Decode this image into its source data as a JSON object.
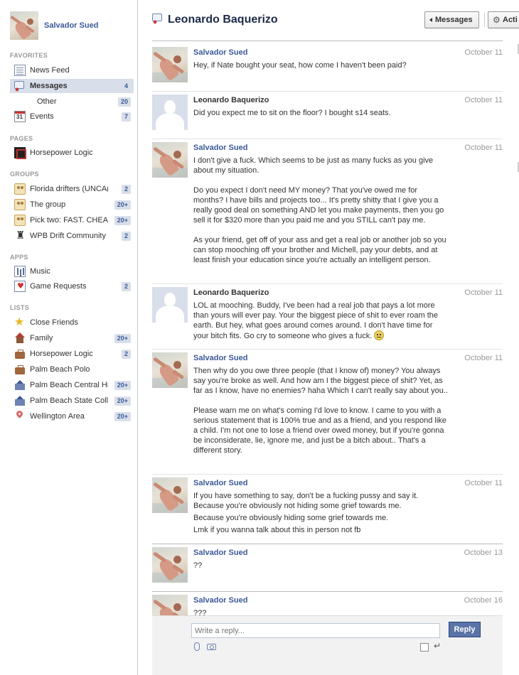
{
  "user": {
    "name": "Salvador Sued"
  },
  "sidebar": {
    "favorites_heading": "FAVORITES",
    "favorites": [
      {
        "label": "News Feed",
        "icon": "news-feed-icon",
        "badge": ""
      },
      {
        "label": "Messages",
        "icon": "messages-icon",
        "badge": "4"
      },
      {
        "label": "Other",
        "icon": "",
        "badge": "20"
      },
      {
        "label": "Events",
        "icon": "calendar-icon",
        "badge": "7"
      }
    ],
    "pages_heading": "PAGES",
    "pages": [
      {
        "label": "Horsepower Logic",
        "icon": "page-icon",
        "badge": ""
      }
    ],
    "groups_heading": "GROUPS",
    "groups": [
      {
        "label": "Florida drifters (UNCA(",
        "icon": "group-icon",
        "badge": "2"
      },
      {
        "label": "The group",
        "icon": "group-icon",
        "badge": "20+"
      },
      {
        "label": "Pick two: FAST. CHEA",
        "icon": "group-icon",
        "badge": "20+"
      },
      {
        "label": "WPB Drift Community",
        "icon": "rook-icon",
        "badge": "2"
      }
    ],
    "apps_heading": "APPS",
    "apps": [
      {
        "label": "Music",
        "icon": "music-icon",
        "badge": ""
      },
      {
        "label": "Game Requests",
        "icon": "game-icon",
        "badge": "2"
      }
    ],
    "lists_heading": "LISTS",
    "lists": [
      {
        "label": "Close Friends",
        "icon": "star-icon",
        "badge": ""
      },
      {
        "label": "Family",
        "icon": "house-icon",
        "badge": "20+"
      },
      {
        "label": "Horsepower Logic",
        "icon": "briefcase-icon",
        "badge": "2"
      },
      {
        "label": "Palm Beach Polo",
        "icon": "briefcase-icon",
        "badge": ""
      },
      {
        "label": "Palm Beach Central Hi",
        "icon": "school-icon",
        "badge": "20+"
      },
      {
        "label": "Palm Beach State Colle",
        "icon": "school-icon",
        "badge": "20+"
      },
      {
        "label": "Wellington Area",
        "icon": "location-pin-icon",
        "badge": "20+"
      }
    ]
  },
  "conversation": {
    "title": "Leonardo Baquerizo",
    "messages_button": "Messages",
    "actions_button": "Acti",
    "messages": [
      {
        "author": "Salvador Sued",
        "date": "October 11",
        "paragraphs": [
          "Hey, if Nate bought your seat, how come I haven't been paid?"
        ]
      },
      {
        "author": "Leonardo Baquerizo",
        "date": "October 11",
        "paragraphs": [
          "Did you expect me to sit on the floor? I bought s14 seats."
        ]
      },
      {
        "author": "Salvador Sued",
        "date": "October 11",
        "paragraphs": [
          "I don't give a fuck. Which seems to be just as many fucks as you give about my situation.",
          "Do you expect I don't need MY money? That you've owed me for months? I have bills and projects too... It's pretty shitty that I give you a really good deal on something AND let you make payments, then you go sell it for $320 more than you paid me and you STILL can't pay me.",
          "As your friend, get off of your ass and get a real job or another job so you can stop mooching off your brother and Michell, pay your debts, and at least finish your education since you're actually an intelligent person."
        ]
      },
      {
        "author": "Leonardo Baquerizo",
        "date": "October 11",
        "paragraphs": [
          "LOL at mooching. Buddy, I've been had a real job that pays a lot more than yours will ever pay. Your the biggest piece of shit to ever roam the earth. But hey, what goes around comes around. I don't have time for your bitch fits. Go cry to someone who gives a fuck."
        ]
      },
      {
        "author": "Salvador Sued",
        "date": "October 11",
        "paragraphs": [
          "Then why do you owe three people (that I know of) money? You always say you're broke as well. And how am I the biggest piece of shit? Yet, as far as I know, have no enemies? haha Which I can't really say about you..",
          "Please warn me on what's coming I'd love to know. I came to you with a serious statement that is 100% true and as a friend, and you respond like a child. I'm not one to lose a friend over owed money, but if you're gonna be inconsiderate, lie, ignore me, and just be a bitch about.. That's a different story."
        ]
      },
      {
        "author": "Salvador Sued",
        "date": "October 11",
        "paragraphs": [
          "If you have something to say, don't be a fucking pussy and say it. Because you're obviously not hiding some grief towards me.",
          "Because you're obviously hiding some grief towards me.",
          "Lmk if you wanna talk about this in person not fb"
        ]
      },
      {
        "author": "Salvador Sued",
        "date": "October 13",
        "paragraphs": [
          "??"
        ]
      },
      {
        "author": "Salvador Sued",
        "date": "October 16",
        "paragraphs": [
          "???"
        ]
      }
    ]
  },
  "reply": {
    "placeholder": "Write a reply...",
    "button": "Reply"
  }
}
